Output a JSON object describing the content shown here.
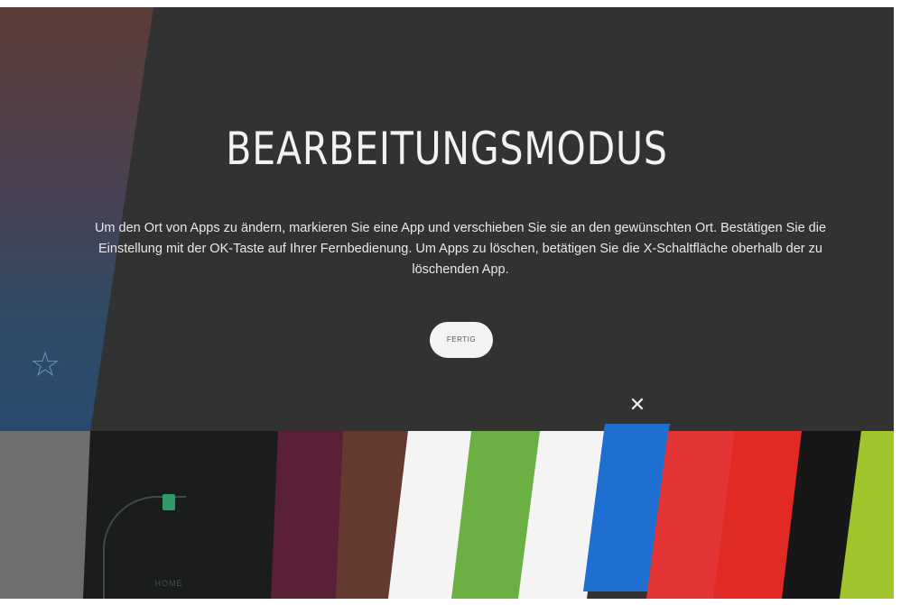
{
  "screen": {
    "title": "BEARBEITUNGSMODUS",
    "description": "Um den Ort von Apps zu ändern, markieren Sie eine App und verschieben Sie sie an den gewünschten Ort. Bestätigen Sie die Einstellung mit der OK-Taste auf Ihrer Fernbedienung. Um Apps zu löschen, betätigen Sie die X-Schaltfläche oberhalb der zu löschenden App.",
    "done_button": "FERTIG",
    "home_label": "HOME",
    "close_symbol": "✕",
    "star_symbol": "☆"
  },
  "tiles": [
    {
      "name": "grey",
      "color": "#6e6e6e"
    },
    {
      "name": "home",
      "color": "#1b1d1d"
    },
    {
      "name": "dark-magenta",
      "color": "#5a2038"
    },
    {
      "name": "brown",
      "color": "#643a30"
    },
    {
      "name": "white",
      "color": "#f4f4f4"
    },
    {
      "name": "green",
      "color": "#6cb043"
    },
    {
      "name": "white-2",
      "color": "#f4f4f4"
    },
    {
      "name": "blue-selected",
      "color": "#1f6fd0"
    },
    {
      "name": "red",
      "color": "#e33535"
    },
    {
      "name": "red-2",
      "color": "#e22a25"
    },
    {
      "name": "black",
      "color": "#171717"
    },
    {
      "name": "lime",
      "color": "#9fc52c"
    }
  ]
}
